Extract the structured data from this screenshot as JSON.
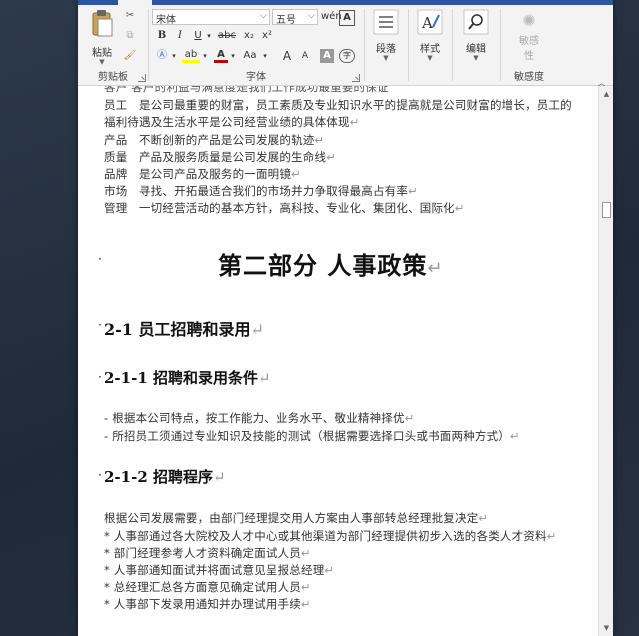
{
  "ribbon": {
    "clipboard": {
      "paste": "粘贴",
      "group": "剪贴板"
    },
    "font": {
      "name": "宋体",
      "size": "五号",
      "bold": "B",
      "italic": "I",
      "underline": "U",
      "strike": "abc",
      "sub": "x₂",
      "sup": "x²",
      "grow": "A",
      "shrink": "A",
      "case": "Aa",
      "group": "字体"
    },
    "paragraph": "段落",
    "styles": "样式",
    "editing": "编辑",
    "sensitivity": {
      "btn_line1": "敏感",
      "btn_line2": "性",
      "group": "敏感度"
    }
  },
  "doc": {
    "top_cut": "客户   客户的利益与满意度是我们工作成功最重要的保证",
    "lines": [
      {
        "label": "员工",
        "text": "是公司最重要的财富，员工素质及专业知识水平的提高就是公司财富的增长，员工的"
      },
      {
        "label": "",
        "text": "福利待遇及生活水平是公司经营业绩的具体体现"
      },
      {
        "label": "产品",
        "text": "不断创新的产品是公司发展的轨迹"
      },
      {
        "label": "质量",
        "text": "产品及服务质量是公司发展的生命线"
      },
      {
        "label": "品牌",
        "text": "是公司产品及服务的一面明镜"
      },
      {
        "label": "市场",
        "text": "寻找、开拓最适合我们的市场并力争取得最高占有率"
      },
      {
        "label": "管理",
        "text": "一切经营活动的基本方针，高科技、专业化、集团化、国际化"
      }
    ],
    "part_title": "第二部分  人事政策",
    "h2_1": "2-1  员工招聘和录用",
    "h3_1": "2-1-1  招聘和录用条件",
    "cond": [
      "- 根据本公司特点，按工作能力、业务水平、敬业精神择优",
      "- 所招员工须通过专业知识及技能的测试（根据需要选择口头或书面两种方式）"
    ],
    "h3_2": "2-1-2  招聘程序",
    "proc_intro": "根据公司发展需要，由部门经理提交用人方案由人事部转总经理批复决定",
    "proc": [
      "*   人事部通过各大院校及人才中心或其他渠道为部门经理提供初步入选的各类人才资料",
      "*   部门经理参考人才资料确定面试人员",
      "*   人事部通知面试并将面试意见呈报总经理",
      "*   总经理汇总各方面意见确定试用人员",
      "* 人事部下发录用通知并办理试用手续"
    ],
    "return_mark": "↵"
  },
  "colors": {
    "accent": "#2b579a",
    "ribbon_bg": "#f3f3f3"
  }
}
